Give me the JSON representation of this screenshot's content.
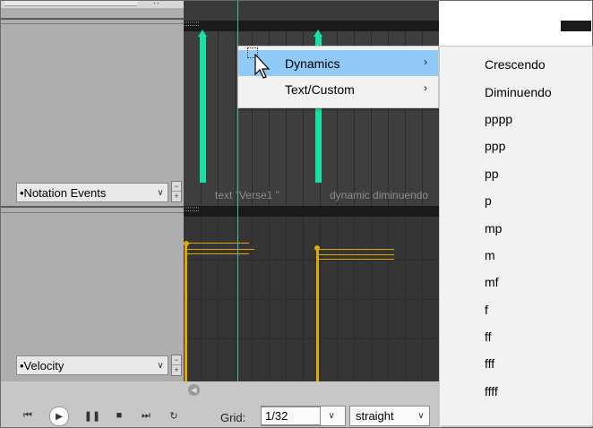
{
  "lanes": {
    "notation_lane": {
      "label": "•Notation Events"
    },
    "velocity_lane": {
      "label": "•Velocity"
    },
    "ruler_marker": "::::::::"
  },
  "arrange": {
    "events": [
      {
        "text": "text \"Verse1 \""
      },
      {
        "text": "dynamic diminuendo"
      }
    ],
    "colors": {
      "note_bar": "#18e0a6",
      "velocity": "#e0a800",
      "background": "#3e3e3e"
    }
  },
  "context_menu": {
    "items": [
      {
        "label": "Dynamics",
        "arrow": "›",
        "highlighted": true
      },
      {
        "label": "Text/Custom",
        "arrow": "›",
        "highlighted": false
      }
    ]
  },
  "dynamics_submenu": {
    "items": [
      "Crescendo",
      "Diminuendo",
      "pppp",
      "ppp",
      "pp",
      "p",
      "mp",
      "m",
      "mf",
      "f",
      "ff",
      "fff",
      "ffff"
    ]
  },
  "transport": {
    "grid_label": "Grid:",
    "grid_value": "1/32",
    "swing_value": "straight",
    "buttons": [
      "skip-back-icon",
      "play-icon",
      "pause-icon",
      "stop-icon",
      "skip-forward-icon",
      "loop-icon"
    ]
  }
}
